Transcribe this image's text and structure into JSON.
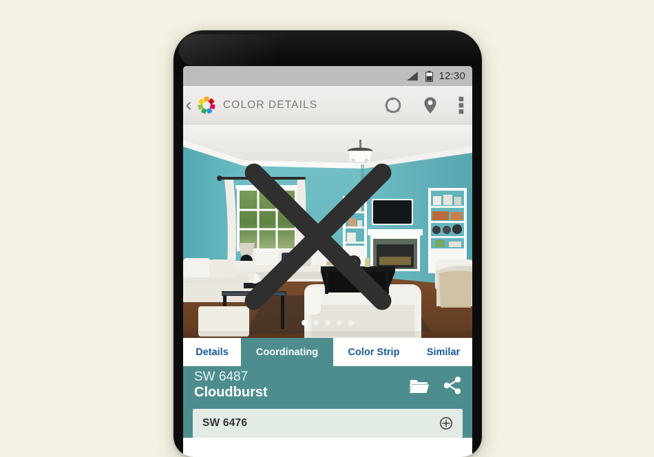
{
  "app": {
    "background_color": "#f5f2e3",
    "accent_teal": "#4d8d8e",
    "link_blue": "#18599c"
  },
  "status_bar": {
    "time": "12:30",
    "signal_icon": "signal-bars-icon",
    "battery_icon": "battery-icon"
  },
  "toolbar": {
    "back_icon": "back-chevron-icon",
    "back_glyph": "‹",
    "logo_icon": "colorsnap-flower-logo-icon",
    "title": "COLOR DETAILS",
    "actions": [
      {
        "name": "sync-refresh-icon",
        "label": "Sync"
      },
      {
        "name": "location-pin-icon",
        "label": "Find a store"
      },
      {
        "name": "overflow-menu-icon",
        "label": "More options"
      }
    ]
  },
  "photo": {
    "alt": "Living room painted in teal with white sofas, fireplace and built-in shelves",
    "close_icon": "close-x-icon",
    "pagination": {
      "count": 5,
      "active_index": 0
    }
  },
  "tabs": [
    {
      "label": "Details",
      "active": false
    },
    {
      "label": "Coordinating",
      "active": true
    },
    {
      "label": "Color Strip",
      "active": false
    },
    {
      "label": "Similar",
      "active": false
    }
  ],
  "color_header": {
    "number": "SW 6487",
    "name": "Cloudburst",
    "actions": [
      {
        "name": "folder-icon",
        "label": "Save to folder"
      },
      {
        "name": "share-icon",
        "label": "Share"
      }
    ]
  },
  "coordinating_list": [
    {
      "number": "SW 6476",
      "add_icon": "add-circle-icon",
      "swatch_color": "#e3ebe5"
    }
  ]
}
